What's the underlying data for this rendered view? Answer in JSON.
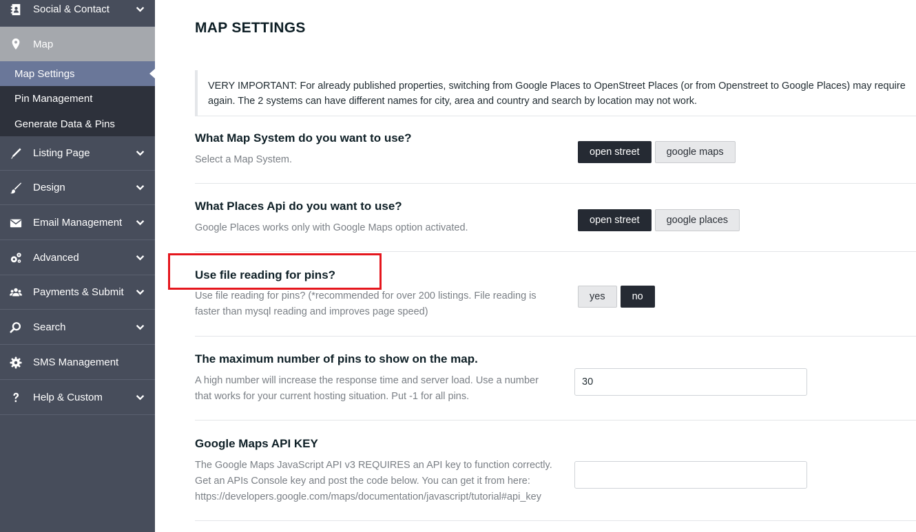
{
  "sidebar": {
    "items": [
      {
        "label": "Social & Contact",
        "icon": "contact-card-icon",
        "has_chevron": true
      },
      {
        "label": "Map",
        "icon": "map-pin-icon",
        "active": true
      },
      {
        "label": "Listing Page",
        "icon": "pencil-icon",
        "has_chevron": true
      },
      {
        "label": "Design",
        "icon": "brush-icon",
        "has_chevron": true
      },
      {
        "label": "Email Management",
        "icon": "envelope-icon",
        "has_chevron": true
      },
      {
        "label": "Advanced",
        "icon": "gears-icon",
        "has_chevron": true
      },
      {
        "label": "Payments & Submit",
        "icon": "users-icon",
        "has_chevron": true
      },
      {
        "label": "Search",
        "icon": "search-icon",
        "has_chevron": true
      },
      {
        "label": "SMS Management",
        "icon": "gear-icon",
        "has_chevron": false
      },
      {
        "label": "Help & Custom",
        "icon": "question-icon",
        "has_chevron": true
      }
    ],
    "submenu": [
      {
        "label": "Map Settings",
        "current": true
      },
      {
        "label": "Pin Management"
      },
      {
        "label": "Generate Data & Pins"
      }
    ]
  },
  "main": {
    "title": "MAP SETTINGS",
    "notice_line1": "VERY IMPORTANT: For already published properties, switching from Google Places to OpenStreet Places (or from Openstreet to Google Places) may require",
    "notice_line2": "again. The 2 systems can have different names for city, area and country and search by location may not work.",
    "settings": {
      "map_system": {
        "title": "What Map System do you want to use?",
        "desc": "Select a Map System.",
        "options": [
          "open street",
          "google maps"
        ],
        "selected": "open street"
      },
      "places_api": {
        "title": "What Places Api do you want to use?",
        "desc": "Google Places works only with Google Maps option activated.",
        "options": [
          "open street",
          "google places"
        ],
        "selected": "open street"
      },
      "file_reading": {
        "title": "Use file reading for pins?",
        "desc_line1": "Use file reading for pins? (*recommended for over 200 listings. File reading is",
        "desc_line2": "faster than mysql reading and improves page speed)",
        "options": [
          "yes",
          "no"
        ],
        "selected": "no"
      },
      "max_pins": {
        "title": "The maximum number of pins to show on the map.",
        "desc_line1": "A high number will increase the response time and server load. Use a number",
        "desc_line2": "that works for your current hosting situation. Put -1 for all pins.",
        "value": "30"
      },
      "api_key": {
        "title": "Google Maps API KEY",
        "desc_line1": "The Google Maps JavaScript API v3 REQUIRES an API key to function correctly.",
        "desc_line2": "Get an APIs Console key and post the code below. You can get it from here:",
        "desc_line3": "https://developers.google.com/maps/documentation/javascript/tutorial#api_key",
        "value": ""
      }
    }
  },
  "colors": {
    "sidebar_bg": "#474d5b",
    "submenu_bg": "#2d313b",
    "submenu_current_bg": "#6a7799",
    "active_item_bg": "#a5a8ad",
    "button_selected_bg": "#252a33",
    "highlight_red": "#e5161d"
  }
}
